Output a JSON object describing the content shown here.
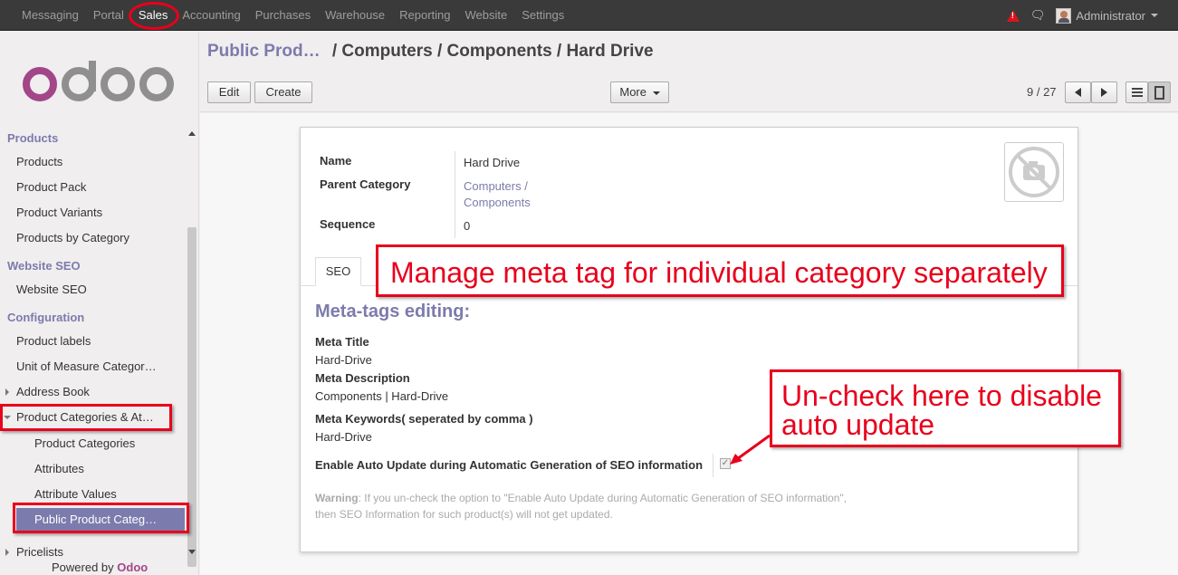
{
  "topbar": {
    "menu": [
      "Messaging",
      "Portal",
      "Sales",
      "Accounting",
      "Purchases",
      "Warehouse",
      "Reporting",
      "Website",
      "Settings"
    ],
    "active": "Sales",
    "user": "Administrator"
  },
  "sidebar": {
    "sections": [
      {
        "title": "Products",
        "items": [
          "Products",
          "Product Pack",
          "Product Variants",
          "Products by Category"
        ]
      },
      {
        "title": "Website SEO",
        "items": [
          "Website SEO"
        ]
      },
      {
        "title": "Configuration",
        "items": [
          "Product labels",
          "Unit of Measure Categor…",
          "Address Book",
          "Product Categories & At…"
        ]
      }
    ],
    "sub_items": [
      "Product Categories",
      "Attributes",
      "Attribute Values",
      "Public Product Categ…"
    ],
    "pricelists": "Pricelists",
    "powered_by": "Powered by",
    "powered_brand": "Odoo"
  },
  "breadcrumb": {
    "parent": "Public Prod…",
    "current": "/ Computers / Components / Hard Drive"
  },
  "toolbar": {
    "edit": "Edit",
    "create": "Create",
    "more": "More",
    "pager": "9 / 27"
  },
  "form": {
    "name_label": "Name",
    "name_value": "Hard Drive",
    "parent_label": "Parent Category",
    "parent_value_line1": "Computers /",
    "parent_value_line2": "Components",
    "sequence_label": "Sequence",
    "sequence_value": "0",
    "tab": "SEO",
    "meta_heading": "Meta-tags editing:",
    "meta_title_label": "Meta Title",
    "meta_title_value": "Hard-Drive",
    "meta_desc_label": "Meta Description",
    "meta_desc_value": "Components | Hard-Drive",
    "meta_kw_label": "Meta Keywords( seperated by comma )",
    "meta_kw_value": "Hard-Drive",
    "auto_update_label": "Enable Auto Update during Automatic Generation of SEO information",
    "auto_update_checked": true,
    "warning_label": "Warning",
    "warning_text": ": If you un-check the option to \"Enable Auto Update during Automatic Generation of SEO information\",",
    "warning_text2": "then SEO Information for such product(s) will not get updated."
  },
  "annotations": {
    "callout_1": "Manage meta tag for individual category separately",
    "callout_2_line1": "Un-check here to disable",
    "callout_2_line2": "auto update",
    "color": "#e8001c"
  }
}
